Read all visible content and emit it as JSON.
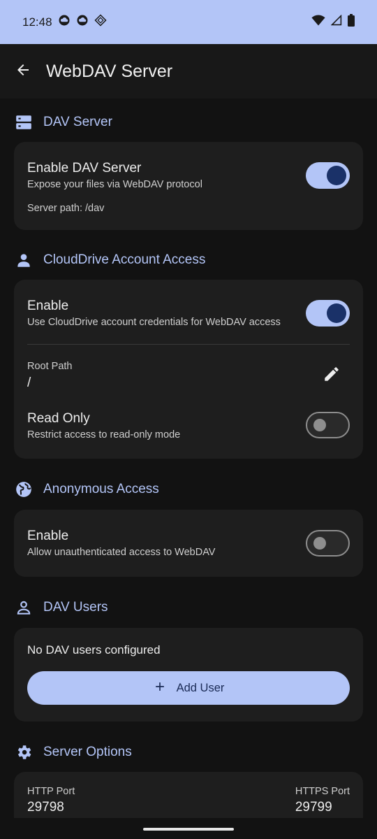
{
  "status_bar": {
    "time": "12:48",
    "left_icons": [
      "cloud-icon",
      "cloud-icon",
      "diamond-app-icon"
    ],
    "right_icons": [
      "wifi-icon",
      "signal-icon",
      "battery-icon"
    ]
  },
  "app_bar": {
    "title": "WebDAV Server",
    "back_icon": "arrow-back-icon"
  },
  "sections": {
    "dav_server": {
      "title": "DAV Server",
      "icon": "server-icon",
      "enable_title": "Enable DAV Server",
      "enable_sub": "Expose your files via WebDAV protocol",
      "enabled": true,
      "server_path": "Server path: /dav"
    },
    "cloud_account": {
      "title": "CloudDrive Account Access",
      "icon": "person-icon",
      "enable_title": "Enable",
      "enable_sub": "Use CloudDrive account credentials for WebDAV access",
      "enabled": true,
      "root_path_label": "Root Path",
      "root_path_value": "/",
      "read_only_title": "Read Only",
      "read_only_sub": "Restrict access to read-only mode",
      "read_only": false
    },
    "anonymous": {
      "title": "Anonymous Access",
      "icon": "globe-icon",
      "enable_title": "Enable",
      "enable_sub": "Allow unauthenticated access to WebDAV",
      "enabled": false
    },
    "dav_users": {
      "title": "DAV Users",
      "icon": "person-outline-icon",
      "empty_text": "No DAV users configured",
      "add_label": "Add User"
    },
    "server_options": {
      "title": "Server Options",
      "icon": "gear-icon",
      "http_label": "HTTP Port",
      "http_value": "29798",
      "https_label": "HTTPS Port",
      "https_value": "29799"
    }
  },
  "colors": {
    "accent": "#b3c5f7",
    "background": "#121212",
    "card": "#1e1e1e",
    "toggle_knob_on": "#1a3168"
  }
}
